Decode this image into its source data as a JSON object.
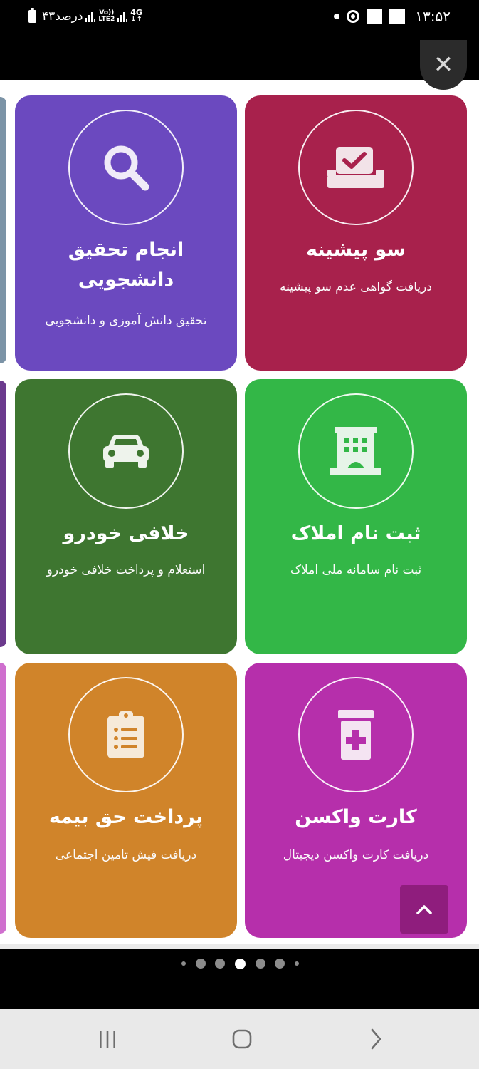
{
  "status_bar": {
    "battery_text": "۴۳درصد",
    "network_tag_top": "Vo))",
    "network_tag_bottom": "LTE2",
    "network_4g": "4G",
    "time": "۱۳:۵۲"
  },
  "top_bar": {
    "close_icon": "close-icon",
    "close_glyph": "✕"
  },
  "cards": [
    {
      "id": "criminal-record",
      "title": "سو پیشینه",
      "description": "دریافت گواهی عدم سو پیشینه",
      "icon": "ballot-box-check-icon",
      "color": "#a8214c"
    },
    {
      "id": "student-research",
      "title": "انجام تحقیق دانشجویی",
      "description": "تحقیق دانش آموزی و دانشجویی",
      "icon": "search-icon",
      "color": "#6b49bf"
    },
    {
      "id": "property-registration",
      "title": "ثبت نام املاک",
      "description": "ثبت نام سامانه ملی املاک",
      "icon": "building-icon",
      "color": "#33b747"
    },
    {
      "id": "car-violations",
      "title": "خلافی خودرو",
      "description": "استعلام و پرداخت خلافی خودرو",
      "icon": "car-icon",
      "color": "#3e7630"
    },
    {
      "id": "vaccine-card",
      "title": "کارت واکسن",
      "description": "دریافت کارت واکسن دیجیتال",
      "icon": "medicine-jar-icon",
      "color": "#b62fab"
    },
    {
      "id": "insurance-payment",
      "title": "پرداخت حق بیمه",
      "description": "دریافت فیش تامین اجتماعی",
      "icon": "clipboard-list-icon",
      "color": "#d0842a"
    }
  ],
  "edge_strip_colors": [
    "#7b93a6",
    "#6b3a8d",
    "#cf6fce"
  ],
  "scroll_top": {
    "icon": "chevron-up-icon",
    "color": "#8f1d7d"
  },
  "pagination": {
    "total": 7,
    "active_index": 3
  },
  "nav_bar": {
    "recents_icon": "recents-icon",
    "home_icon": "home-icon",
    "back_icon": "back-icon"
  }
}
